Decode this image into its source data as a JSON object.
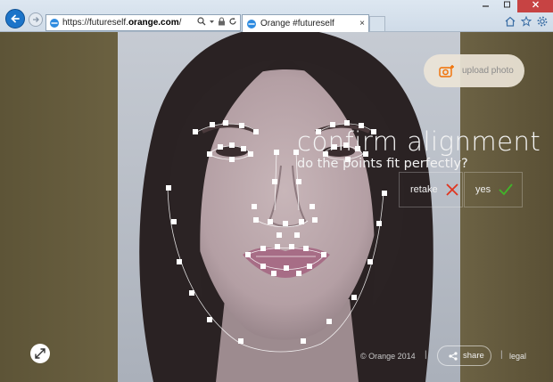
{
  "browser": {
    "url_prefix": "https://futureself.",
    "url_domain": "orange.com",
    "url_suffix": "/",
    "tab_title": "Orange #futureself",
    "tab_close": "×"
  },
  "page": {
    "title": "confirm alignment",
    "subtitle": "do the points fit perfectly?",
    "retake_label": "retake",
    "yes_label": "yes",
    "upload_label": "upload photo",
    "copyright": "© Orange 2014",
    "separator": "|",
    "share_label": "share",
    "legal_label": "legal",
    "colors": {
      "accent": "#f16e00",
      "retake": "#e0341e",
      "yes": "#41b32a"
    }
  }
}
